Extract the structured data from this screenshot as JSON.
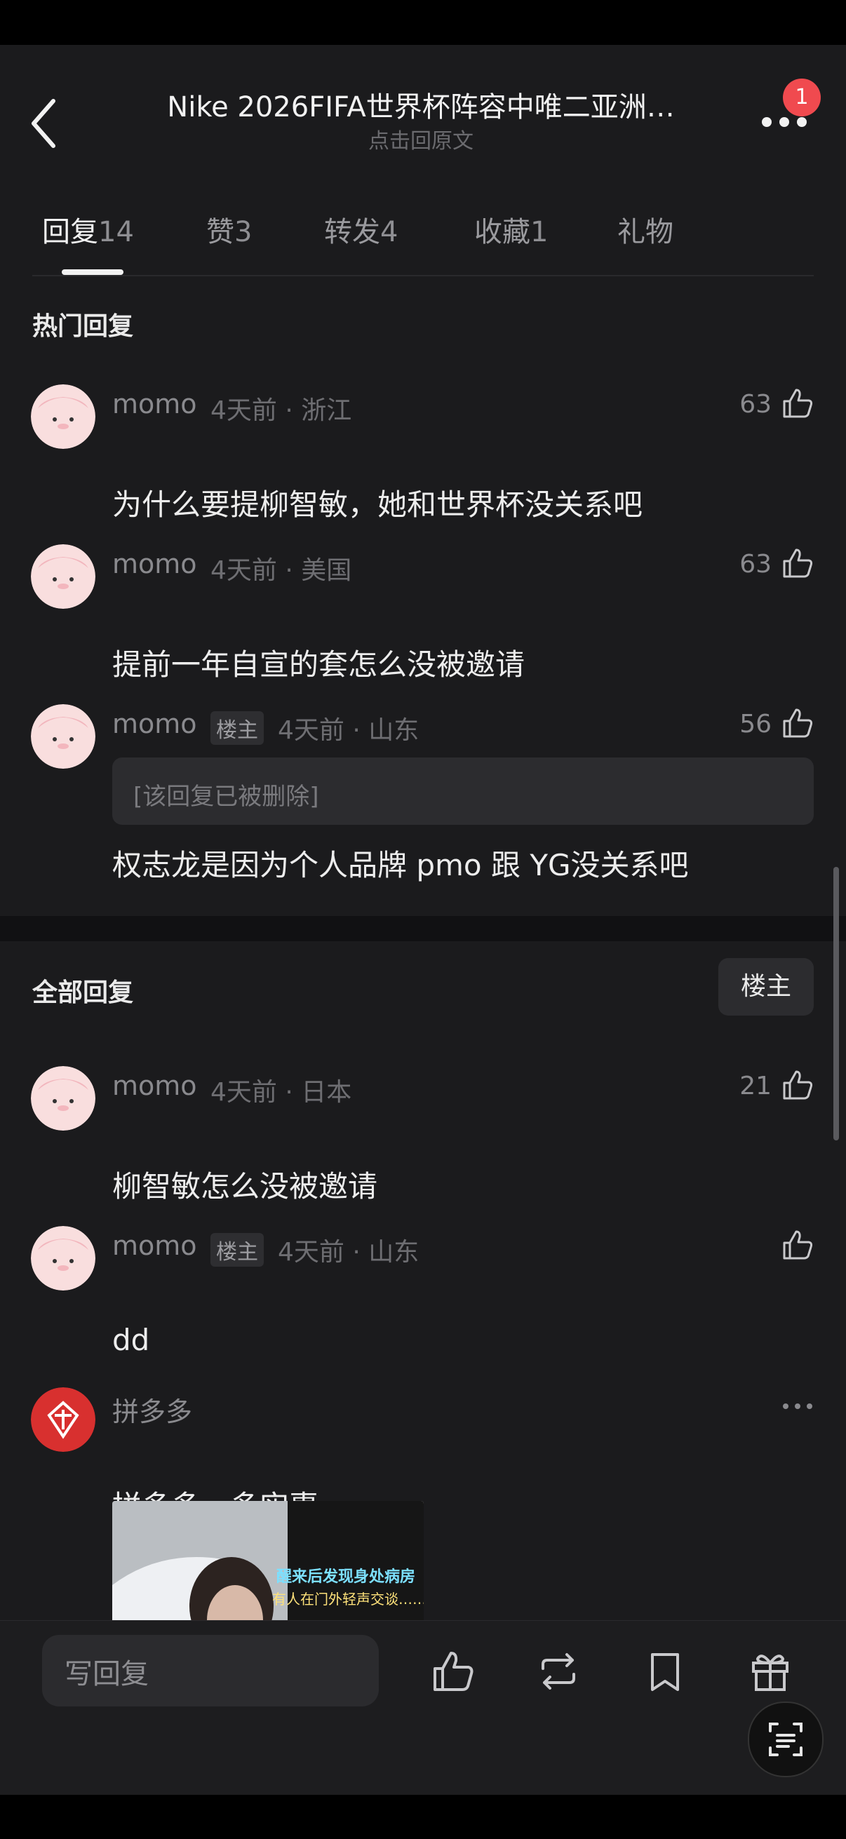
{
  "header": {
    "title": "Nike 2026FIFA世界杯阵容中唯二亚洲…",
    "subtitle": "点击回原文",
    "notification_count": "1"
  },
  "tabs": [
    {
      "label": "回复",
      "count": "14"
    },
    {
      "label": "赞",
      "count": "3"
    },
    {
      "label": "转发",
      "count": "4"
    },
    {
      "label": "收藏",
      "count": "1"
    },
    {
      "label": "礼物",
      "count": ""
    }
  ],
  "hot_section": {
    "title": "热门回复",
    "comments": [
      {
        "name": "momo",
        "meta": "4天前 · 浙江",
        "likes": "63",
        "text": "为什么要提柳智敏，她和世界杯没关系吧"
      },
      {
        "name": "momo",
        "meta": "4天前 · 美国",
        "likes": "63",
        "text": "提前一年自宣的套怎么没被邀请"
      },
      {
        "name": "momo",
        "tag": "楼主",
        "meta": "4天前 · 山东",
        "likes": "56",
        "quote": "[该回复已被删除]",
        "text": "权志龙是因为个人品牌 pmo 跟 YG没关系吧"
      }
    ]
  },
  "all_section": {
    "title": "全部回复",
    "filter_label": "楼主",
    "comments": [
      {
        "name": "momo",
        "meta": "4天前 · 日本",
        "likes": "21",
        "text": "柳智敏怎么没被邀请"
      },
      {
        "name": "momo",
        "tag": "楼主",
        "meta": "4天前 · 山东",
        "likes": "",
        "text": "dd"
      },
      {
        "name": "拼多多",
        "text": "拼多多，多实惠",
        "image_line1": "醒来后发现身处病房",
        "image_line2": "有人在门外轻声交谈……"
      }
    ]
  },
  "bottom_bar": {
    "placeholder": "写回复"
  },
  "colors": {
    "background": "#1b1b1d",
    "badge": "#f04a4f",
    "pdd_red": "#d8302f"
  }
}
